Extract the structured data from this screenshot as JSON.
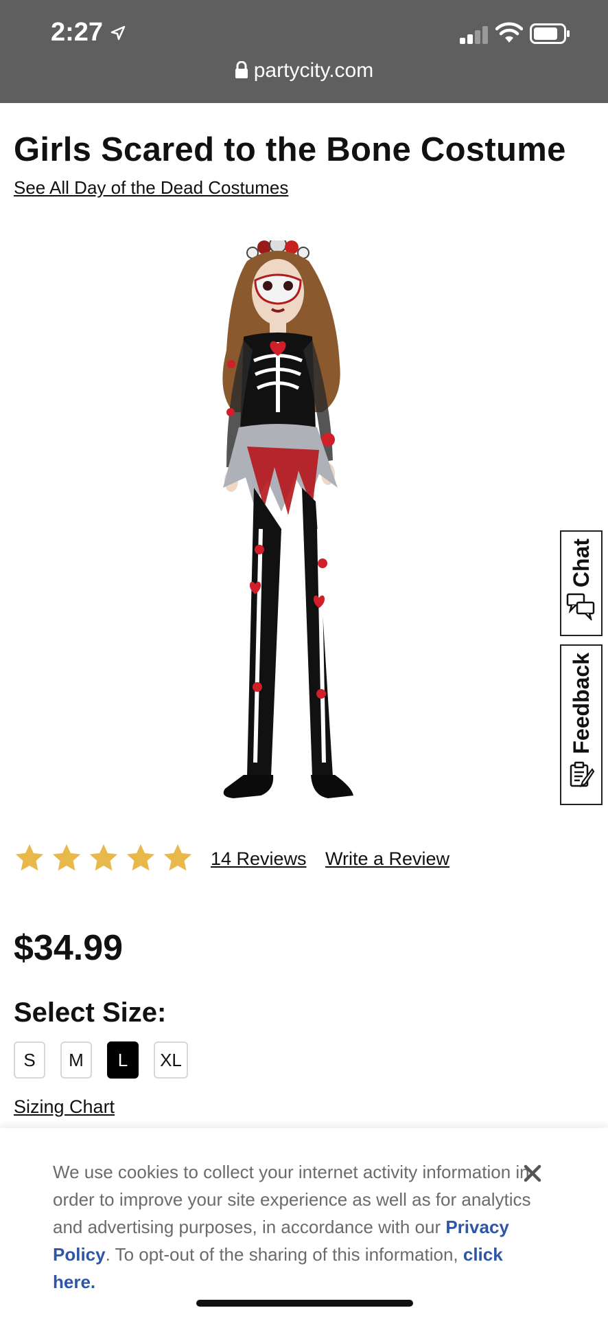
{
  "status_bar": {
    "time": "2:27",
    "url": "partycity.com"
  },
  "product": {
    "title": "Girls Scared to the Bone Costume",
    "see_all_link": "See All Day of the Dead Costumes",
    "rating_stars": 5,
    "reviews_link": "14 Reviews",
    "write_review_link": "Write a Review",
    "price": "$34.99",
    "select_size_label": "Select Size:",
    "sizes": [
      "S",
      "M",
      "L",
      "XL"
    ],
    "selected_size": "L",
    "sizing_chart_link": "Sizing Chart"
  },
  "side_tabs": {
    "chat": "Chat",
    "feedback": "Feedback"
  },
  "cookie_banner": {
    "text_before": "We use cookies to collect your internet activity information in order to improve your site experience as well as for analytics and advertising purposes, in accordance with our ",
    "privacy_link": "Privacy Policy",
    "text_middle": ". To opt-out of the sharing of this information, ",
    "opt_out_link": "click here."
  },
  "colors": {
    "status_bar_bg": "#5f5f5f",
    "star": "#e8b94a",
    "link_blue": "#2d56a6",
    "selected_size_bg": "#000000"
  },
  "icons": [
    "location-arrow-icon",
    "signal-icon",
    "wifi-icon",
    "battery-icon",
    "lock-icon",
    "star-icon",
    "chat-bubbles-icon",
    "feedback-clipboard-icon",
    "close-icon"
  ]
}
